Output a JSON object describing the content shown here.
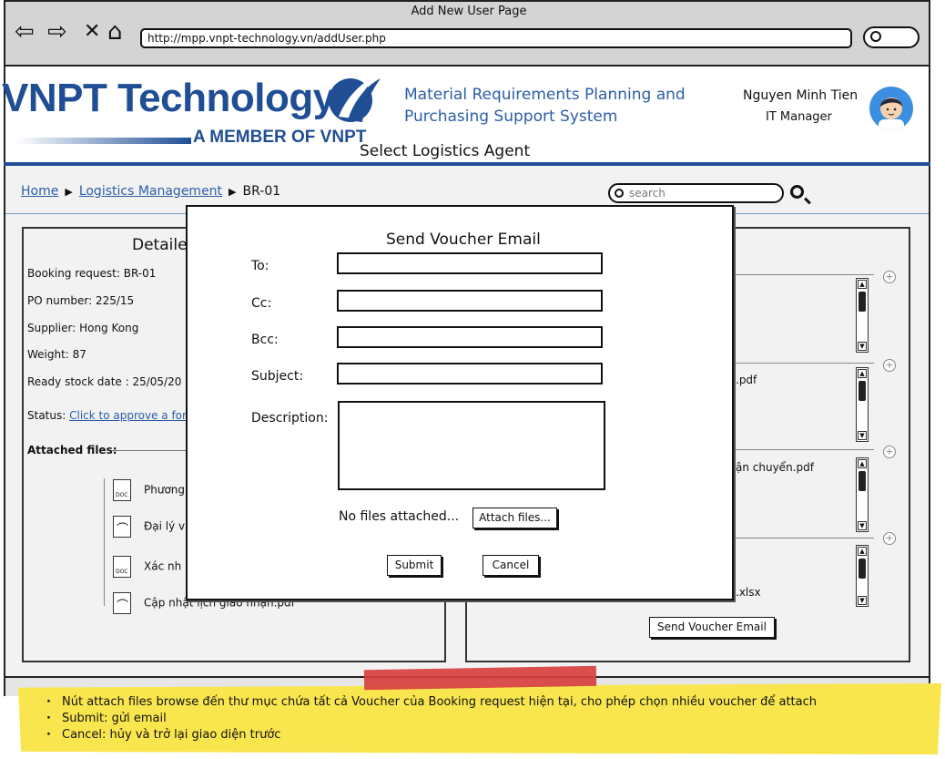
{
  "browser": {
    "title": "Add New User Page",
    "url": "http://mpp.vnpt-technology.vn/addUser.php"
  },
  "header": {
    "logo_text": "VNPT Technology",
    "logo_sub": "A MEMBER OF VNPT",
    "system_title_line1": "Material Requirements Planning and",
    "system_title_line2": "Purchasing Support System",
    "user_name": "Nguyen Minh Tien",
    "user_role": "IT Manager",
    "page_heading": "Select Logistics Agent"
  },
  "breadcrumb": {
    "home": "Home",
    "section": "Logistics Management",
    "current": "BR-01"
  },
  "search": {
    "placeholder": "search"
  },
  "details": {
    "title": "Detaile",
    "booking": "Booking request: BR-01",
    "po": "PO number: 225/15",
    "supplier": "Supplier: Hong Kong",
    "weight": "Weight: 87",
    "ready": "Ready stock date : 25/05/20",
    "status_label": "Status:",
    "status_link": "Click to approve a for",
    "attached_label": "Attached files:",
    "files": [
      {
        "type": "doc",
        "name": "Phương"
      },
      {
        "type": "pdf",
        "name": "Đại lý v"
      },
      {
        "type": "doc",
        "name": "Xác nh"
      },
      {
        "type": "pdf",
        "name": "Cập nhật lịch giao nhận.pdf"
      }
    ]
  },
  "right_panel": {
    "file2": ".pdf",
    "file3": "ận chuyển.pdf",
    "file4": ".xlsx",
    "send_voucher_label": "Send Voucher Email"
  },
  "modal": {
    "title": "Send Voucher Email",
    "to_label": "To:",
    "cc_label": "Cc:",
    "bcc_label": "Bcc:",
    "subject_label": "Subject:",
    "description_label": "Description:",
    "no_files": "No files attached...",
    "attach_label": "Attach files...",
    "submit_label": "Submit",
    "cancel_label": "Cancel"
  },
  "notes": [
    "Nút attach files browse đến thư mục chứa tất cả Voucher của Booking request hiện tại, cho phép chọn nhiều voucher để attach",
    "Submit: gửi email",
    "Cancel: hủy và trở lại giao diện trước"
  ],
  "colors": {
    "brand": "#1f4e95",
    "link": "#2b5ea7",
    "note": "#f9e64f",
    "tape": "#d94040"
  }
}
